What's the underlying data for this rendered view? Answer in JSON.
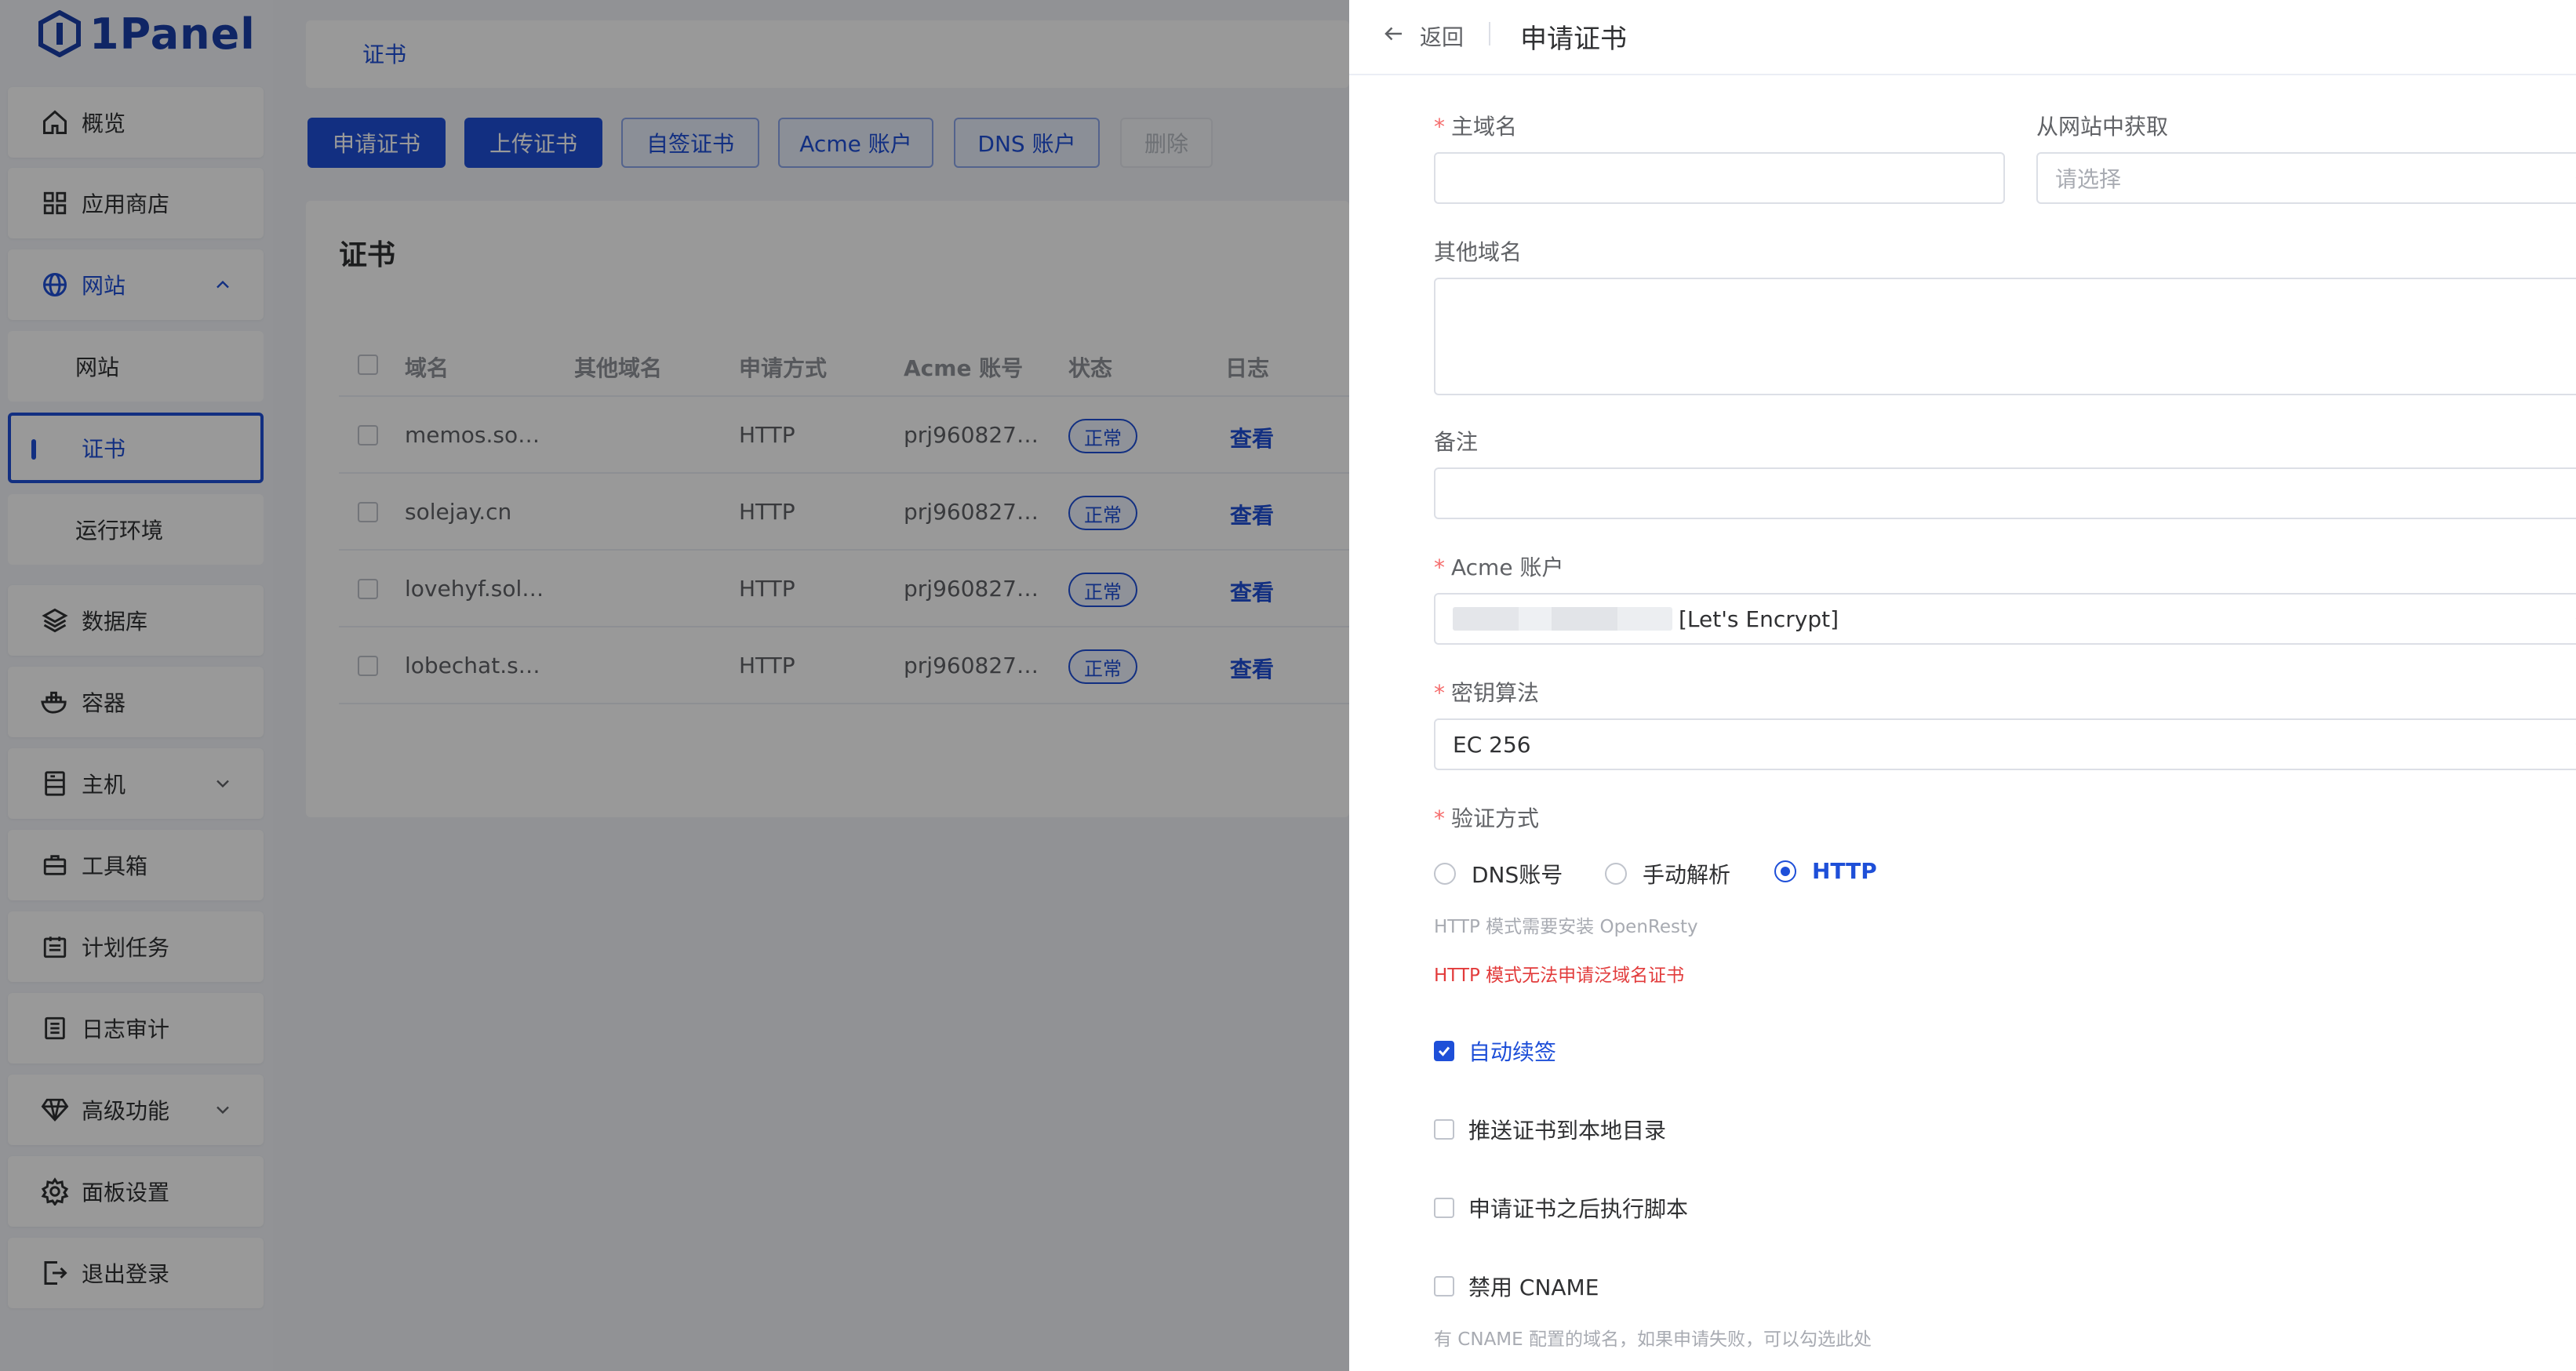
{
  "app": {
    "logo_text": "1Panel"
  },
  "sidebar": {
    "items": [
      {
        "label": "概览",
        "icon": "home-icon"
      },
      {
        "label": "应用商店",
        "icon": "grid-icon"
      },
      {
        "label": "网站",
        "icon": "globe-icon",
        "expanded": true
      },
      {
        "label": "网站",
        "sub": true
      },
      {
        "label": "证书",
        "sub": true,
        "selected": true
      },
      {
        "label": "运行环境",
        "sub": true
      },
      {
        "label": "数据库",
        "icon": "layers-icon"
      },
      {
        "label": "容器",
        "icon": "docker-icon"
      },
      {
        "label": "主机",
        "icon": "server-icon",
        "has_chevron": true
      },
      {
        "label": "工具箱",
        "icon": "toolbox-icon"
      },
      {
        "label": "计划任务",
        "icon": "calendar-icon"
      },
      {
        "label": "日志审计",
        "icon": "list-icon"
      },
      {
        "label": "高级功能",
        "icon": "diamond-icon",
        "has_chevron": true
      },
      {
        "label": "面板设置",
        "icon": "gear-icon"
      },
      {
        "label": "退出登录",
        "icon": "logout-icon"
      }
    ]
  },
  "main": {
    "breadcrumb": "证书",
    "toolbar": [
      "申请证书",
      "上传证书",
      "自签证书",
      "Acme 账户",
      "DNS 账户",
      "删除"
    ],
    "panel_title": "证书",
    "columns": [
      "域名",
      "其他域名",
      "申请方式",
      "Acme 账号",
      "状态",
      "日志"
    ],
    "rows": [
      {
        "domain": "memos.so…",
        "other": "",
        "method": "HTTP",
        "acme": "prj960827…",
        "status": "正常",
        "log": "查看"
      },
      {
        "domain": "solejay.cn",
        "other": "",
        "method": "HTTP",
        "acme": "prj960827…",
        "status": "正常",
        "log": "查看"
      },
      {
        "domain": "lovehyf.sol…",
        "other": "",
        "method": "HTTP",
        "acme": "prj960827…",
        "status": "正常",
        "log": "查看"
      },
      {
        "domain": "lobechat.s…",
        "other": "",
        "method": "HTTP",
        "acme": "prj960827…",
        "status": "正常",
        "log": "查看"
      }
    ]
  },
  "drawer": {
    "back": "返回",
    "title": "申请证书",
    "primary_domain_label": "主域名",
    "from_site_label": "从网站中获取",
    "from_site_placeholder": "请选择",
    "other_domains_label": "其他域名",
    "remark_label": "备注",
    "acme_label": "Acme 账户",
    "acme_value": "[Let's Encrypt]",
    "key_algo_label": "密钥算法",
    "key_algo_value": "EC 256",
    "verify_label": "验证方式",
    "verify_options": [
      "DNS账号",
      "手动解析",
      "HTTP"
    ],
    "verify_selected": "HTTP",
    "http_hint": "HTTP 模式需要安装 OpenResty",
    "http_warning": "HTTP 模式无法申请泛域名证书",
    "auto_renew": "自动续签",
    "push_local": "推送证书到本地目录",
    "exec_script": "申请证书之后执行脚本",
    "disable_cname": "禁用 CNAME",
    "cname_hint": "有 CNAME 配置的域名，如果申请失败，可以勾选此处"
  },
  "colors": {
    "accent": "#1e4fd8",
    "danger": "#e23b3b",
    "required": "#f56c6c"
  }
}
